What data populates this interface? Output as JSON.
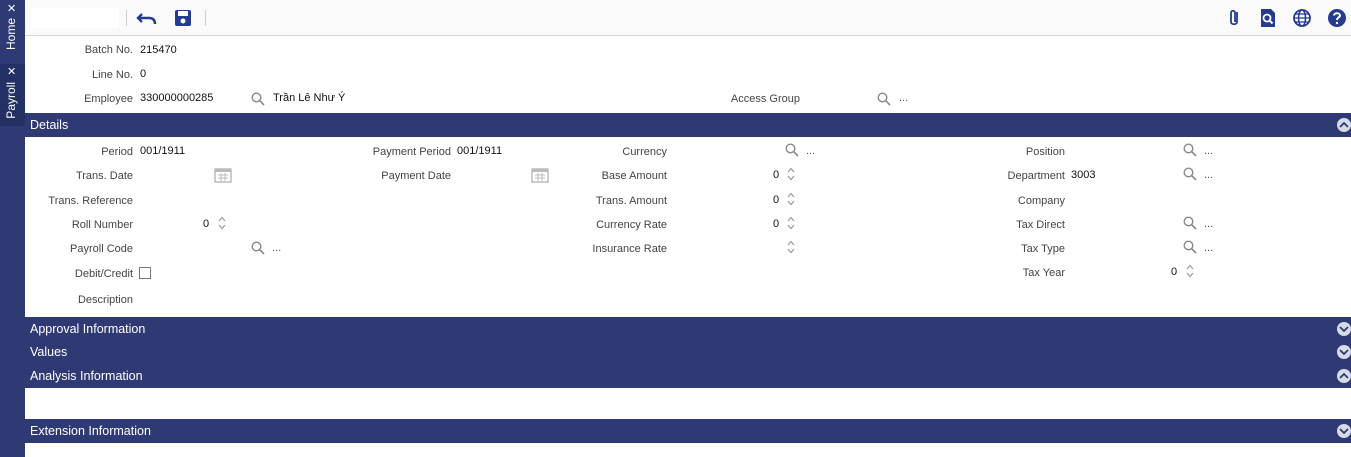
{
  "tabs": [
    {
      "label": "Home"
    },
    {
      "label": "Payroll"
    }
  ],
  "header": {
    "batch_no_label": "Batch No.",
    "batch_no": "215470",
    "line_no_label": "Line No.",
    "line_no": "0",
    "employee_label": "Employee",
    "employee_code": "330000000285",
    "employee_name": "Trần Lê Như Ý",
    "access_group_label": "Access Group"
  },
  "details": {
    "title": "Details",
    "period_label": "Period",
    "period": "001/1911",
    "trans_date_label": "Trans. Date",
    "trans_reference_label": "Trans. Reference",
    "roll_number_label": "Roll Number",
    "roll_number": "0",
    "payroll_code_label": "Payroll Code",
    "debit_credit_label": "Debit/Credit",
    "description_label": "Description",
    "payment_period_label": "Payment Period",
    "payment_period": "001/1911",
    "payment_date_label": "Payment Date",
    "currency_label": "Currency",
    "base_amount_label": "Base Amount",
    "base_amount": "0",
    "trans_amount_label": "Trans. Amount",
    "trans_amount": "0",
    "currency_rate_label": "Currency Rate",
    "currency_rate": "0",
    "insurance_rate_label": "Insurance Rate",
    "position_label": "Position",
    "department_label": "Department",
    "department": "3003",
    "company_label": "Company",
    "tax_direct_label": "Tax Direct",
    "tax_type_label": "Tax Type",
    "tax_year_label": "Tax Year",
    "tax_year": "0"
  },
  "sections": {
    "approval": "Approval Information",
    "values": "Values",
    "analysis": "Analysis Information",
    "extension": "Extension Information"
  },
  "ellipsis": "...",
  "colors": {
    "band": "#2f3a74",
    "accent": "#243b8f"
  }
}
